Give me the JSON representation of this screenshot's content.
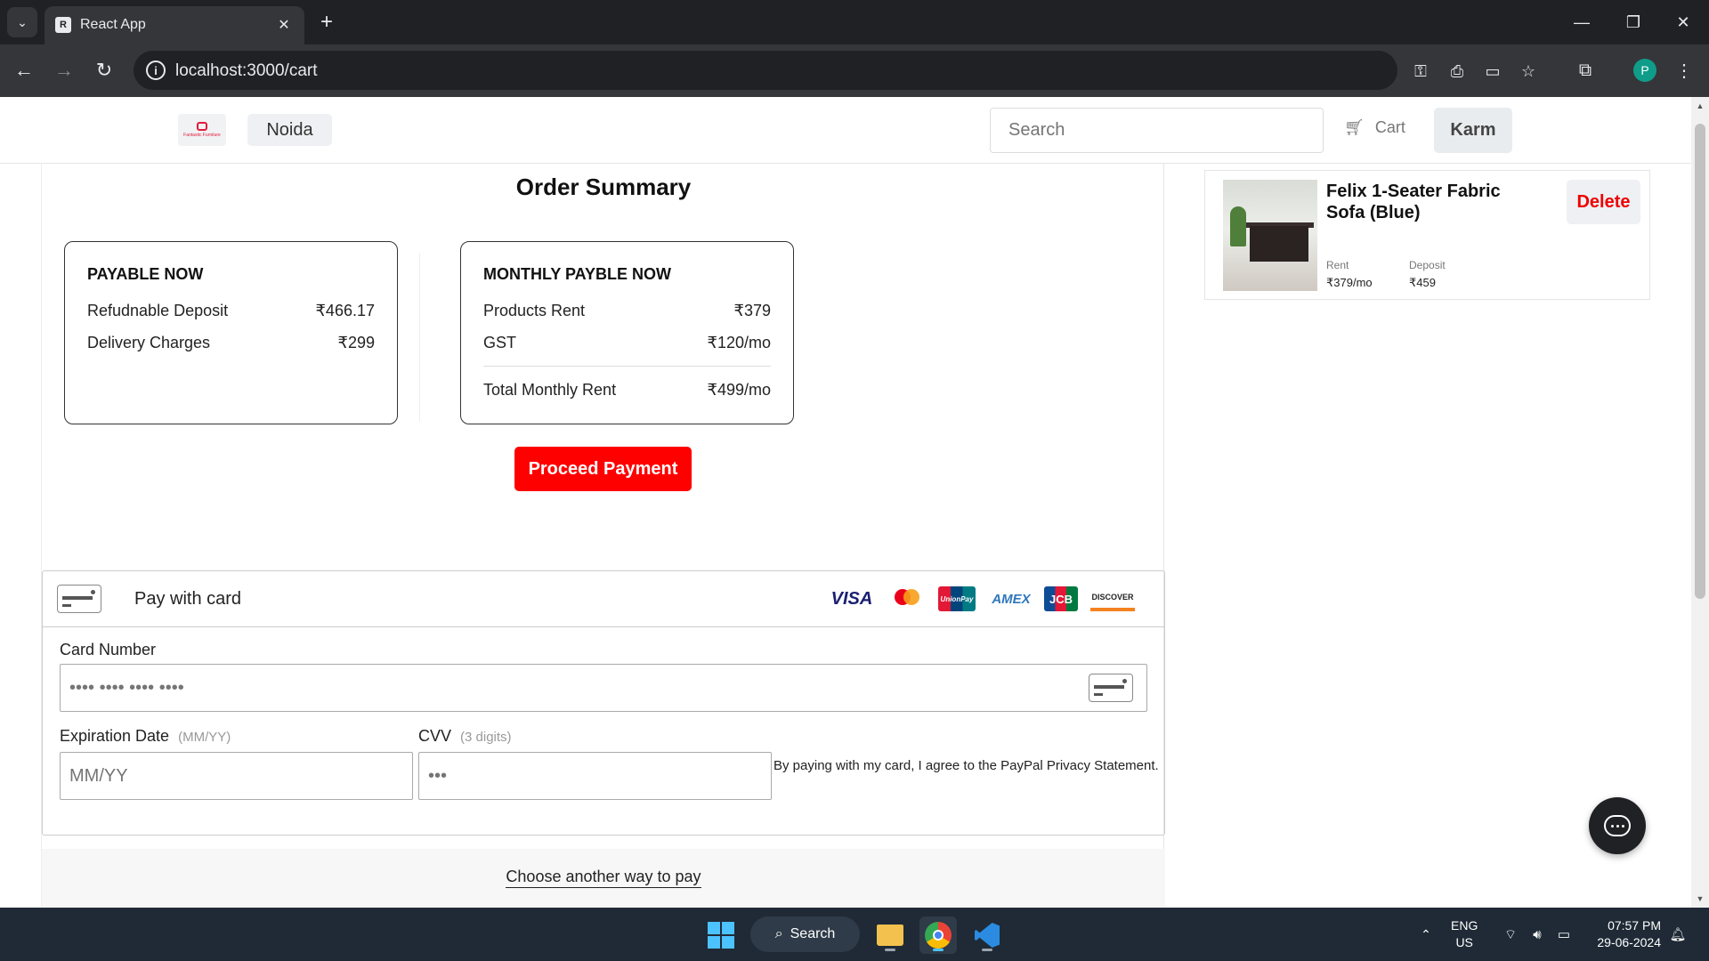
{
  "browser": {
    "tab_title": "React App",
    "url": "localhost:3000/cart",
    "profile_initial": "P"
  },
  "navbar": {
    "logo_text": "Fantastic Furniture",
    "city": "Noida",
    "search_placeholder": "Search",
    "cart_label": "Cart",
    "user_name": "Karm"
  },
  "order_summary": {
    "title": "Order Summary",
    "payable_now": {
      "heading": "PAYABLE NOW",
      "rows": [
        {
          "label": "Refudnable Deposit",
          "value": "₹466.17"
        },
        {
          "label": "Delivery Charges",
          "value": "₹299"
        }
      ]
    },
    "monthly": {
      "heading": "MONTHLY PAYBLE NOW",
      "rows": [
        {
          "label": "Products Rent",
          "value": "₹379"
        },
        {
          "label": "GST",
          "value": "₹120/mo"
        }
      ],
      "total": {
        "label": "Total Monthly Rent",
        "value": "₹499/mo"
      }
    },
    "proceed_label": "Proceed Payment"
  },
  "payment": {
    "title": "Pay with card",
    "brands": [
      "VISA",
      "mastercard",
      "UnionPay",
      "AMEX",
      "JCB",
      "DISCOVER"
    ],
    "card_number_label": "Card Number",
    "card_number_placeholder": "•••• •••• •••• ••••",
    "expiry_label": "Expiration Date",
    "expiry_hint": "(MM/YY)",
    "expiry_placeholder": "MM/YY",
    "cvv_label": "CVV",
    "cvv_hint": "(3 digits)",
    "cvv_placeholder": "•••",
    "agreement": "By paying with my card, I agree to the PayPal Privacy Statement.",
    "another_way": "Choose another way to pay"
  },
  "cart_item": {
    "name": "Felix 1-Seater Fabric Sofa (Blue)",
    "delete_label": "Delete",
    "rent_label": "Rent",
    "rent_value": "₹379/mo",
    "deposit_label": "Deposit",
    "deposit_value": "₹459"
  },
  "taskbar": {
    "search_label": "Search",
    "lang_line1": "ENG",
    "lang_line2": "US",
    "time": "07:57 PM",
    "date": "29-06-2024"
  },
  "colors": {
    "accent_red": "#ff0000",
    "delete_red": "#e00000",
    "chrome_dark": "#202124"
  }
}
